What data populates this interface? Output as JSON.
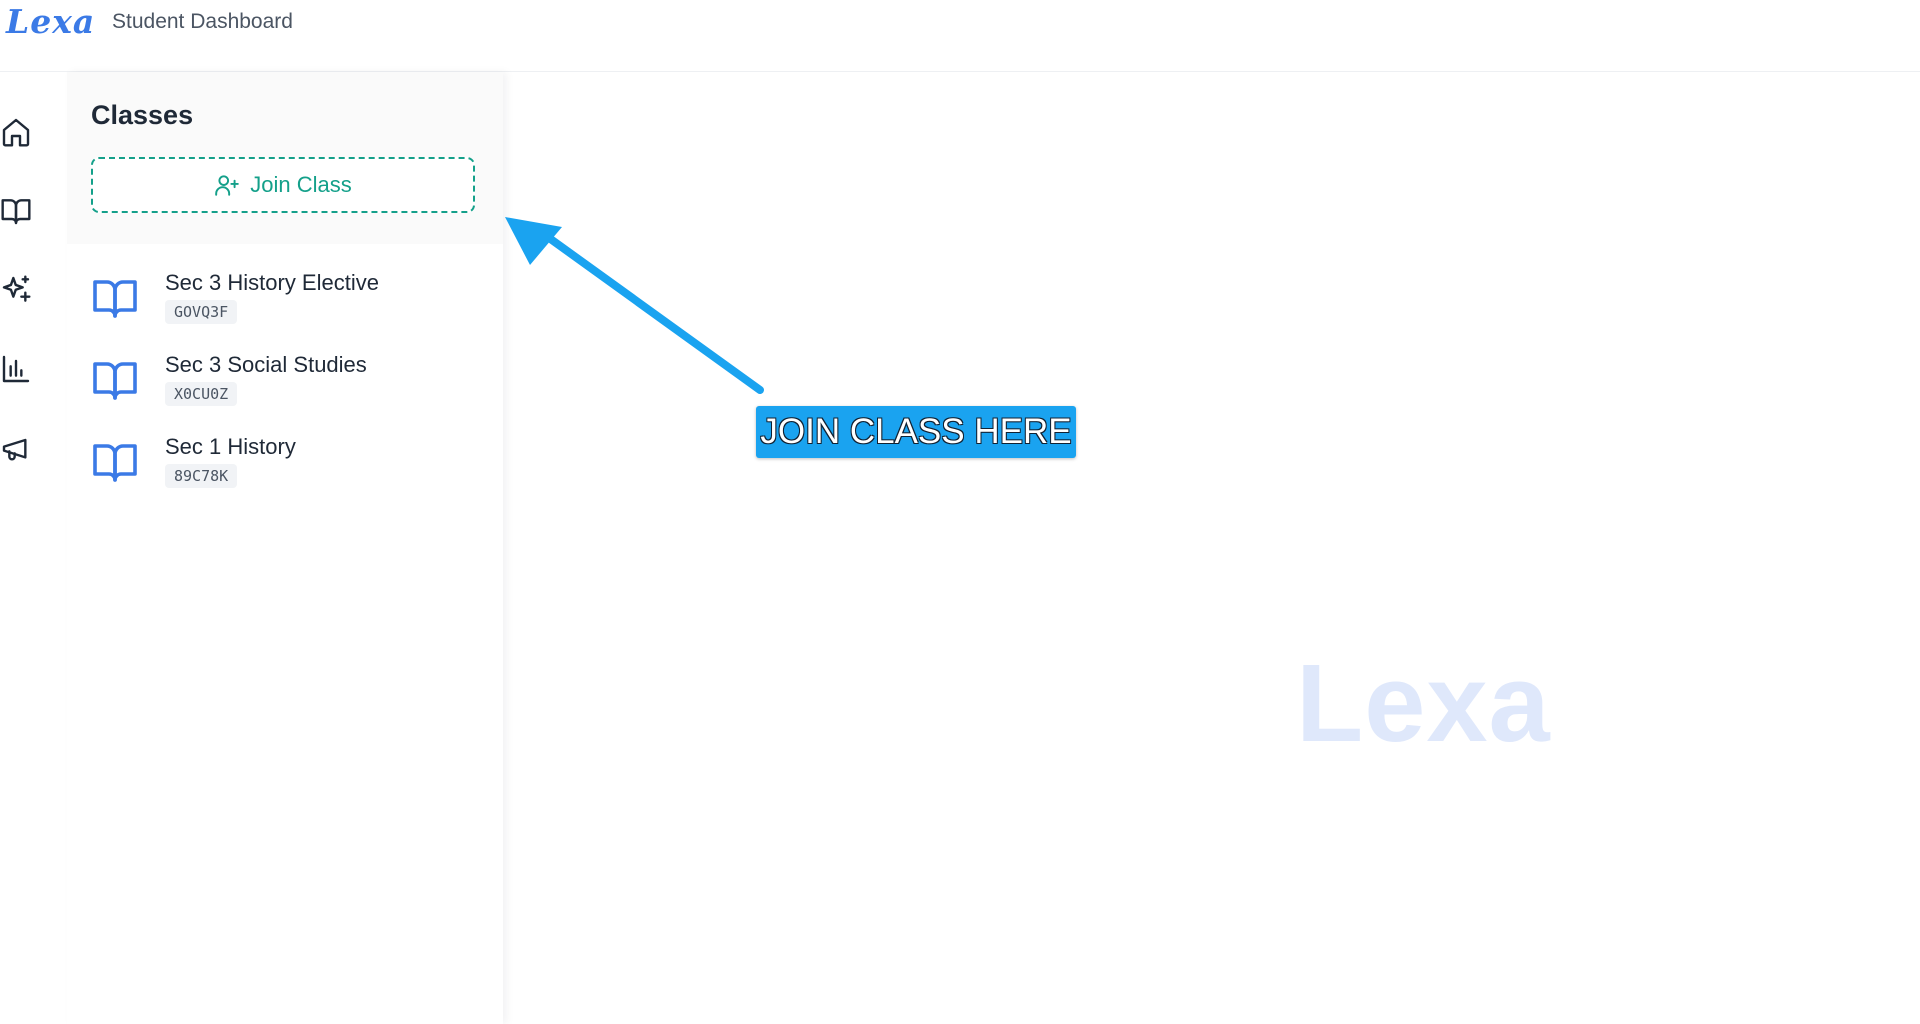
{
  "header": {
    "logo_text": "Lexa",
    "app_title": "Student Dashboard"
  },
  "rail": {
    "items": [
      {
        "icon": "home-icon"
      },
      {
        "icon": "book-icon"
      },
      {
        "icon": "sparkles-icon"
      },
      {
        "icon": "bar-chart-icon"
      },
      {
        "icon": "megaphone-icon"
      }
    ]
  },
  "classes_panel": {
    "title": "Classes",
    "join_button_label": "Join Class",
    "classes": [
      {
        "name": "Sec 3 History Elective",
        "code": "GOVQ3F"
      },
      {
        "name": "Sec 3 Social Studies",
        "code": "X0CU0Z"
      },
      {
        "name": "Sec 1 History",
        "code": "89C78K"
      }
    ]
  },
  "watermark": "Lexa",
  "annotation": {
    "label": "JOIN CLASS HERE"
  },
  "colors": {
    "brand": "#3b7ae6",
    "teal": "#14a08a",
    "callout": "#1aa3f0",
    "watermark": "#dfe8fb"
  }
}
